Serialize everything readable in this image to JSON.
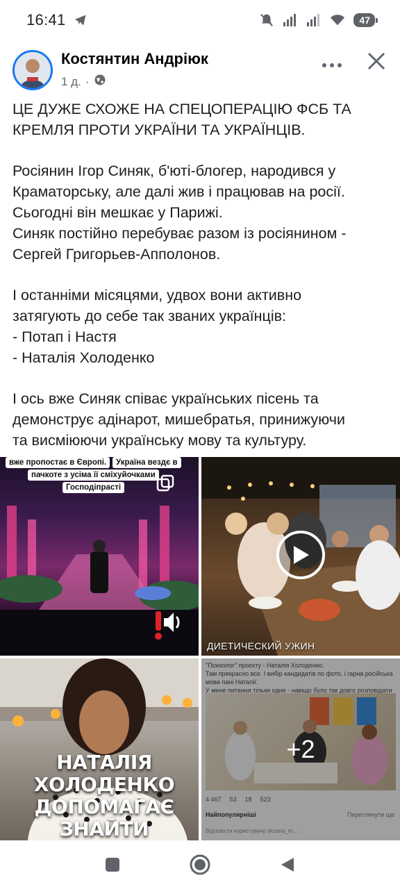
{
  "status_bar": {
    "time": "16:41",
    "battery": "47",
    "icons": [
      "telegram-icon",
      "mute-icon",
      "signal-icon",
      "signal-icon",
      "wifi-icon",
      "battery-icon"
    ]
  },
  "post": {
    "author": "Костянтин Андріюк",
    "time_ago": "1 д.",
    "privacy_icon": "globe-icon",
    "text_lines": [
      "ЦЕ ДУЖЕ СХОЖЕ НА СПЕЦОПЕРАЦІЮ ФСБ ТА",
      "КРЕМЛЯ ПРОТИ УКРАЇНИ ТА УКРАЇНЦІВ.",
      "",
      "Росіянин Ігор Синяк, б'юті-блогер, народився у",
      "Краматорську, але далі жив і працював на росії.",
      "Сьогодні він мешкає у Парижі.",
      "Синяк постійно перебуває разом із росіянином -",
      "Сергей Григорьев-Апполонов.",
      "",
      "І останніми місяцями, удвох вони активно",
      "затягують до себе так званих українців:",
      "- Потап і Настя",
      "- Наталія Холоденко",
      "",
      "І ось вже Синяк співає українських пісень та",
      "демонструє адінарот, мишебратья, принижуючи",
      "та висміюючи українську мову та культуру."
    ]
  },
  "media": {
    "tile1": {
      "caption_line1": "вже пропостає в Європі.",
      "caption_line2": "Україна вездє в",
      "caption_line3": "пачкоте з усіма її сміхуйочками",
      "caption_line4": "Господіпрасті"
    },
    "tile2": {
      "caption": "ДИЕТИЧЕСКИЙ УЖИН"
    },
    "tile3": {
      "title_line1": "НАТАЛІЯ ХОЛОДЕНКО",
      "title_line2": "ДОПОМАГАЄ ЗНАЙТИ"
    },
    "tile4": {
      "text_line1": "\"Психолог\" проєкту - Наталія Холоденко.",
      "text_line2": "Там прекрасно все. І вибір кандидатів по фото, і гарна російська мова пані Наталії.",
      "text_line3": "У мене питання тільки одне - навіщо було так довго розповідати \"про випадкові зустрічі у Монако і не тільки\"?)",
      "likes": "4 467",
      "comments": "53",
      "reposts": "18",
      "shares": "523",
      "sort_label": "Найпопулярніші",
      "sort_right": "Переглянути ще",
      "comment_hint": "Відповісти користувачу oksana_m...",
      "more_count": "+2"
    }
  },
  "nav": {
    "icons": [
      "recents-icon",
      "home-icon",
      "back-icon"
    ]
  }
}
